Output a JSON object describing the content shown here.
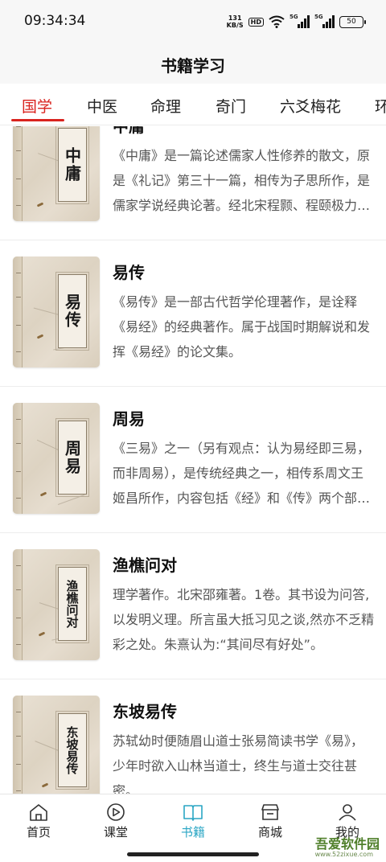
{
  "status": {
    "time": "09:34:34",
    "net_speed_value": "131",
    "net_speed_unit": "KB/S",
    "hd": "HD",
    "signal_label_1": "5G",
    "signal_label_2": "5G",
    "battery": "50"
  },
  "header": {
    "title": "书籍学习"
  },
  "tabs": [
    {
      "label": "国学",
      "active": true
    },
    {
      "label": "中医"
    },
    {
      "label": "命理"
    },
    {
      "label": "奇门"
    },
    {
      "label": "六爻梅花"
    },
    {
      "label": "环"
    }
  ],
  "books": [
    {
      "title": "中庸",
      "cover": "中庸",
      "desc": "《中庸》是一篇论述儒家人性修养的散文，原是《礼记》第三十一篇，相传为子思所作，是儒家学说经典论著。经北宋程颢、程颐极力尊崇。"
    },
    {
      "title": "易传",
      "cover": "易传",
      "desc": "《易传》是一部古代哲学伦理著作，是诠释《易经》的经典著作。属于战国时期解说和发挥《易经》的论文集。"
    },
    {
      "title": "周易",
      "cover": "周易",
      "desc": "《三易》之一（另有观点：认为易经即三易，而非周易），是传统经典之一，相传系周文王姬昌所作，内容包括《经》和《传》两个部分。"
    },
    {
      "title": "渔樵问对",
      "cover": "渔樵问对",
      "desc": "理学著作。北宋邵雍著。1卷。其书设为问答,以发明义理。所言虽大抵习见之谈,然亦不乏精彩之处。朱熹认为:“其间尽有好处”。"
    },
    {
      "title": "东坡易传",
      "cover": "东坡易传",
      "desc": "苏轼幼时便随眉山道士张易简读书学《易》，少年时欲入山林当道士，终生与道士交往甚密。"
    }
  ],
  "nav": [
    {
      "label": "首页",
      "icon": "home-icon"
    },
    {
      "label": "课堂",
      "icon": "play-circle-icon"
    },
    {
      "label": "书籍",
      "icon": "book-icon",
      "active": true
    },
    {
      "label": "商城",
      "icon": "store-icon"
    },
    {
      "label": "我的",
      "icon": "user-icon"
    }
  ],
  "watermark": {
    "text": "吾爱软件园",
    "url": "www.52zixue.com"
  },
  "colors": {
    "accent": "#d9231e",
    "nav_active": "#2aa6c4"
  }
}
